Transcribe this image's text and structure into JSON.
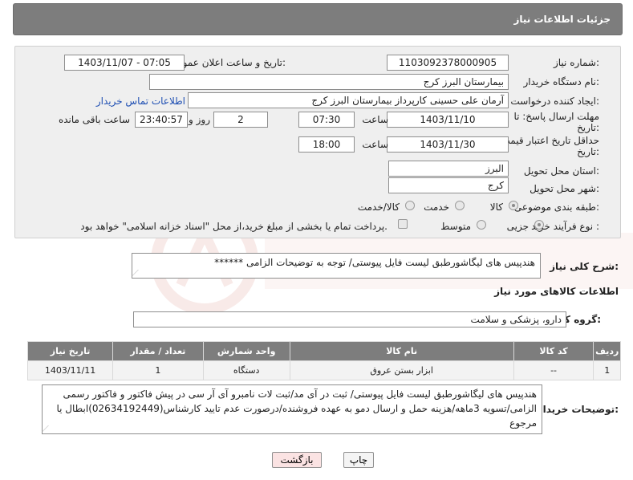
{
  "header": {
    "title": "جزئیات اطلاعات نیاز"
  },
  "form": {
    "need_number": {
      "label": "شماره نیاز:",
      "value": "1103092378000905"
    },
    "announce_datetime": {
      "label": "تاریخ و ساعت اعلان عمومی:",
      "value": "1403/11/07 - 07:05"
    },
    "buyer_org": {
      "label": "نام دستگاه خریدار:",
      "value": "بیمارستان البرز کرج"
    },
    "requester": {
      "label": "ایجاد کننده درخواست:",
      "value": "آرمان علی حسینی کارپرداز بیمارستان البرز کرج",
      "contact_link": "اطلاعات تماس خریدار"
    },
    "reply_deadline": {
      "label_line1": "مهلت ارسال پاسخ: تا",
      "label_line2": "تاریخ:",
      "date": "1403/11/10",
      "time_label": "ساعت",
      "time": "07:30",
      "days": "2",
      "days_label": "روز و",
      "remaining": "23:40:57",
      "remaining_label": "ساعت باقی مانده"
    },
    "price_validity": {
      "label_line1": "حداقل تاریخ اعتبار قیمت: تا",
      "label_line2": "تاریخ:",
      "date": "1403/11/30",
      "time_label": "ساعت",
      "time": "18:00"
    },
    "delivery_province": {
      "label": "استان محل تحویل:",
      "value": "البرز"
    },
    "delivery_city": {
      "label": "شهر محل تحویل:",
      "value": "کرج"
    },
    "category": {
      "label": "طبقه بندی موضوعی:",
      "options": [
        "کالا",
        "خدمت",
        "کالا/خدمت"
      ],
      "selected": "کالا"
    },
    "purchase_type": {
      "label": "نوع فرآیند خرید :",
      "options": [
        "جزیی",
        "متوسط"
      ],
      "selected": "جزیی",
      "payment_note": "پرداخت تمام یا بخشی از مبلغ خرید،از محل \"اسناد خزانه اسلامی\" خواهد بود."
    }
  },
  "description": {
    "label": "شرح کلی نیاز:",
    "value": "هندپیس های لیگاشورطبق لیست فایل پیوستی/ توجه به توضیحات الزامی ******"
  },
  "goods_section": {
    "title": "اطلاعات کالاهای مورد نیاز"
  },
  "goods_group": {
    "label": "گروه کالا:",
    "value": "دارو، پزشکی و سلامت"
  },
  "table": {
    "headers": [
      "ردیف",
      "کد کالا",
      "نام کالا",
      "واحد شمارش",
      "تعداد / مقدار",
      "تاریخ نیاز"
    ],
    "rows": [
      [
        "1",
        "--",
        "ابزار بستن عروق",
        "دستگاه",
        "1",
        "1403/11/11"
      ]
    ]
  },
  "buyer_notes": {
    "label": "توضیحات خریدار:",
    "value": "هندپیس های لیگاشورطبق لیست فایل پیوستی/ ثبت در آی مد/ثبت لات نامبرو آی آر سی در پیش فاکتور و فاکتور رسمی الزامی/تسویه 3ماهه/هزینه حمل و ارسال دمو به عهده فروشنده/درصورت عدم تایید کارشناس(02634192449)ابطال یا مرجوع"
  },
  "buttons": {
    "print": "چاپ",
    "back": "بازگشت"
  },
  "colors": {
    "header_bg": "#7d7d7d",
    "panel_bg": "#efefef",
    "link": "#1f4fb3",
    "back_btn": "#fbe3e3"
  }
}
